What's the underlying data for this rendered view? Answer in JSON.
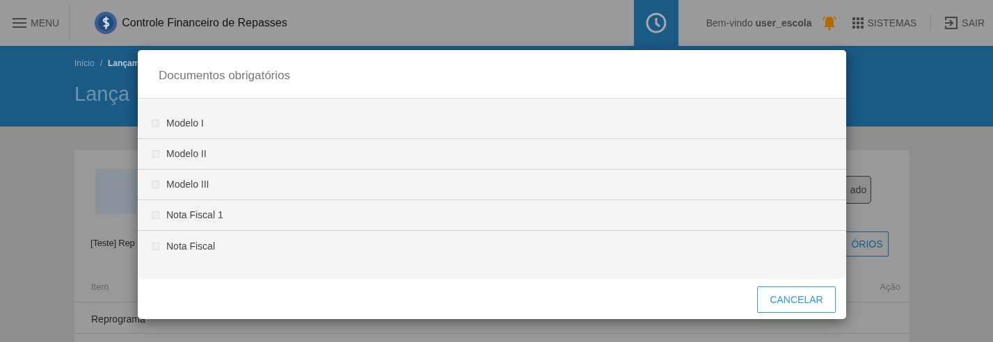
{
  "header": {
    "menu_label": "MENU",
    "app_title": "Controle Financeiro de Repasses",
    "welcome": "Bem-vindo",
    "user": "user_escola",
    "systems_label": "SISTEMAS",
    "logout_label": "SAIR"
  },
  "page": {
    "breadcrumb": [
      {
        "label": "Início"
      },
      {
        "label": "Lançam"
      }
    ],
    "breadcrumb_separator": "/",
    "title": "Lança",
    "subtitle": "[Teste] Rep",
    "button_1": "ado",
    "button_2": "ÓRIOS",
    "table": {
      "columns": [
        "Item",
        "Ação"
      ],
      "rows": [
        [
          "Reprograma"
        ]
      ]
    }
  },
  "modal": {
    "title": "Documentos obrigatórios",
    "documents": [
      {
        "label": "Modelo I",
        "checked": false
      },
      {
        "label": "Modelo II",
        "checked": false
      },
      {
        "label": "Modelo III",
        "checked": false
      },
      {
        "label": "Nota Fiscal 1",
        "checked": false
      },
      {
        "label": "Nota Fiscal",
        "checked": false
      }
    ],
    "cancel_label": "CANCELAR"
  }
}
